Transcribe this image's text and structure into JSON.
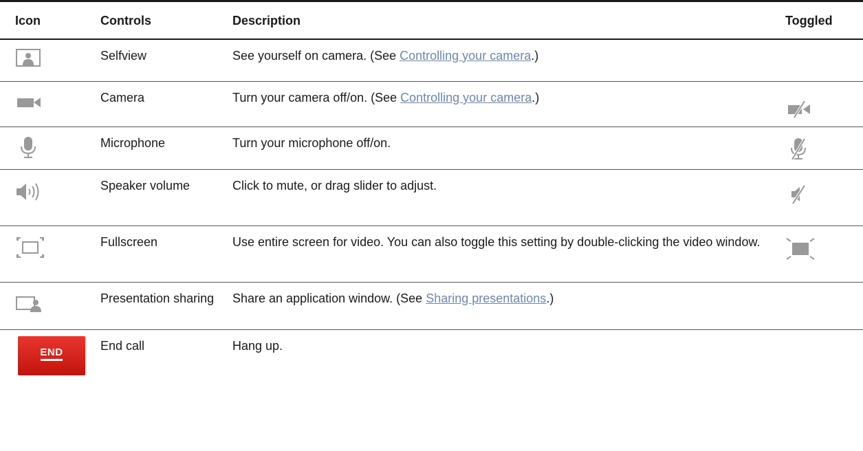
{
  "table": {
    "headers": {
      "icon": "Icon",
      "controls": "Controls",
      "description": "Description",
      "toggled": "Toggled"
    },
    "rows": [
      {
        "icon": "selfview-icon",
        "control": "Selfview",
        "desc_before": "See yourself on camera. (See ",
        "desc_link": "Controlling your camera",
        "desc_after": ".)",
        "toggled_icon": ""
      },
      {
        "icon": "camera-icon",
        "control": "Camera",
        "desc_before": "Turn your camera off/on. (See ",
        "desc_link": "Controlling your camera",
        "desc_after": ".)",
        "toggled_icon": "camera-off-icon"
      },
      {
        "icon": "microphone-icon",
        "control": "Microphone",
        "desc_before": "Turn your microphone off/on.",
        "desc_link": "",
        "desc_after": "",
        "toggled_icon": "microphone-off-icon"
      },
      {
        "icon": "speaker-volume-icon",
        "control": "Speaker volume",
        "desc_before": "Click to mute, or drag slider to adjust.",
        "desc_link": "",
        "desc_after": "",
        "toggled_icon": "speaker-muted-icon"
      },
      {
        "icon": "fullscreen-icon",
        "control": "Fullscreen",
        "desc_before": "Use entire screen for video. You can also toggle this setting by double-clicking the video window.",
        "desc_link": "",
        "desc_after": "",
        "toggled_icon": "exit-fullscreen-icon"
      },
      {
        "icon": "presentation-sharing-icon",
        "control": "Presentation sharing",
        "desc_before": "Share an application window. (See ",
        "desc_link": "Sharing presentations",
        "desc_after": ".)",
        "toggled_icon": ""
      },
      {
        "icon": "end-call-icon",
        "icon_label": "END",
        "control": "End call",
        "desc_before": "Hang up.",
        "desc_link": "",
        "desc_after": "",
        "toggled_icon": ""
      }
    ]
  },
  "colors": {
    "icon_gray": "#999999",
    "link": "#6c87aa",
    "end_button": "#d42a22"
  }
}
